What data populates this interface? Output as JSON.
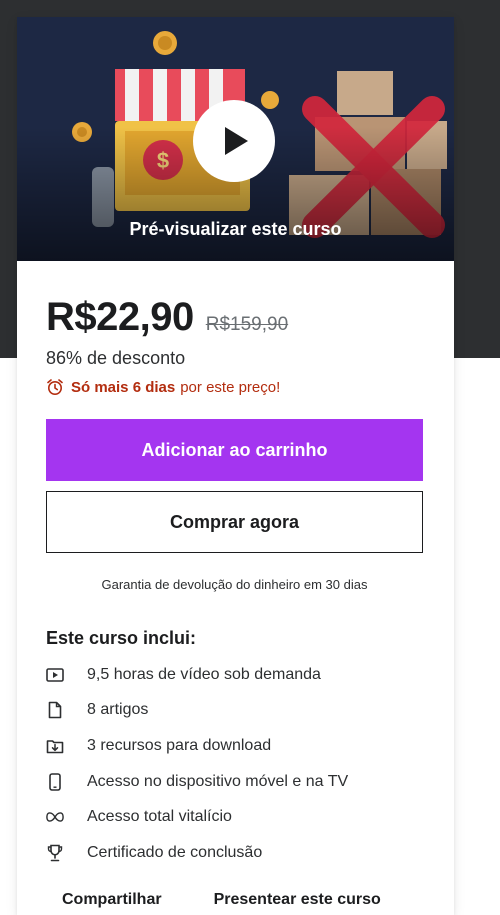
{
  "preview": {
    "label": "Pré-visualizar este curso",
    "play_icon": "play-icon"
  },
  "pricing": {
    "current_price": "R$22,90",
    "original_price": "R$159,90",
    "discount_text": "86% de desconto",
    "urgency_bold": "Só mais 6 dias",
    "urgency_rest": "por este preço!",
    "urgency_icon": "alarm-clock-icon"
  },
  "actions": {
    "add_to_cart_label": "Adicionar ao carrinho",
    "buy_now_label": "Comprar agora",
    "guarantee_text": "Garantia de devolução do dinheiro em 30 dias"
  },
  "includes": {
    "title": "Este curso inclui:",
    "items": [
      {
        "icon": "video-icon",
        "text": "9,5 horas de vídeo sob demanda"
      },
      {
        "icon": "file-icon",
        "text": "8 artigos"
      },
      {
        "icon": "download-icon",
        "text": "3 recursos para download"
      },
      {
        "icon": "mobile-icon",
        "text": "Acesso no dispositivo móvel e na TV"
      },
      {
        "icon": "infinity-icon",
        "text": "Acesso total vitalício"
      },
      {
        "icon": "trophy-icon",
        "text": "Certificado de conclusão"
      }
    ]
  },
  "footer": {
    "share_label": "Compartilhar",
    "gift_label": "Presentear este curso"
  },
  "colors": {
    "accent": "#a435f0",
    "urgency": "#b32d0f",
    "dark_band": "#2d2f31"
  }
}
